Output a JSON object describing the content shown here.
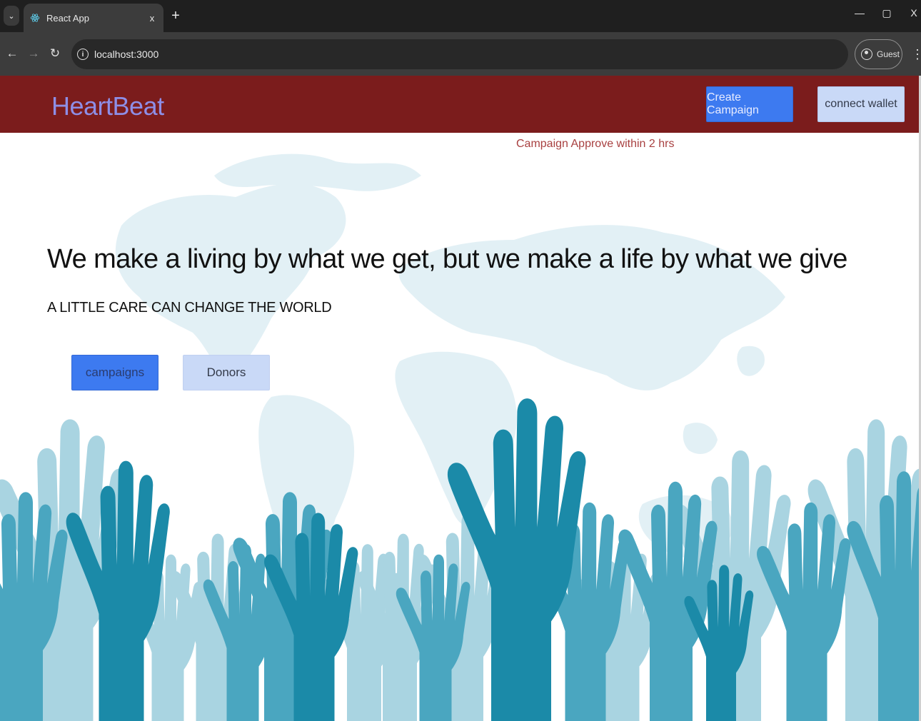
{
  "browser": {
    "tab_title": "React App",
    "tab_close": "x",
    "new_tab": "+",
    "url": "localhost:3000",
    "profile_label": "Guest",
    "window_controls": {
      "minimize": "—",
      "restore": "▢",
      "close": "X"
    }
  },
  "navbar": {
    "brand": "HeartBeat",
    "create_campaign_label": "Create Campaign",
    "connect_wallet_label": "connect wallet"
  },
  "hero": {
    "notice": "Campaign Approve within 2 hrs",
    "headline": "We make a living by what we get, but we make a life by what we give",
    "subline": "A LITTLE CARE CAN CHANGE THE WORLD",
    "campaigns_label": "campaigns",
    "donors_label": "Donors"
  },
  "colors": {
    "navbar_bg": "#7b1c1c",
    "brand": "#8e8ee6",
    "primary_button": "#3d7af0",
    "secondary_button": "#c9d9f7",
    "notice": "#a84040",
    "map": "#e2f0f5",
    "hand_dark": "#1b8aa8",
    "hand_mid": "#4aa6c0",
    "hand_light": "#a9d4e1"
  },
  "icons": {
    "favicon": "react-logo-icon",
    "back": "arrow-left-icon",
    "forward": "arrow-right-icon",
    "reload": "reload-icon",
    "site_info": "info-icon",
    "profile": "person-icon",
    "menu": "kebab-menu-icon"
  }
}
